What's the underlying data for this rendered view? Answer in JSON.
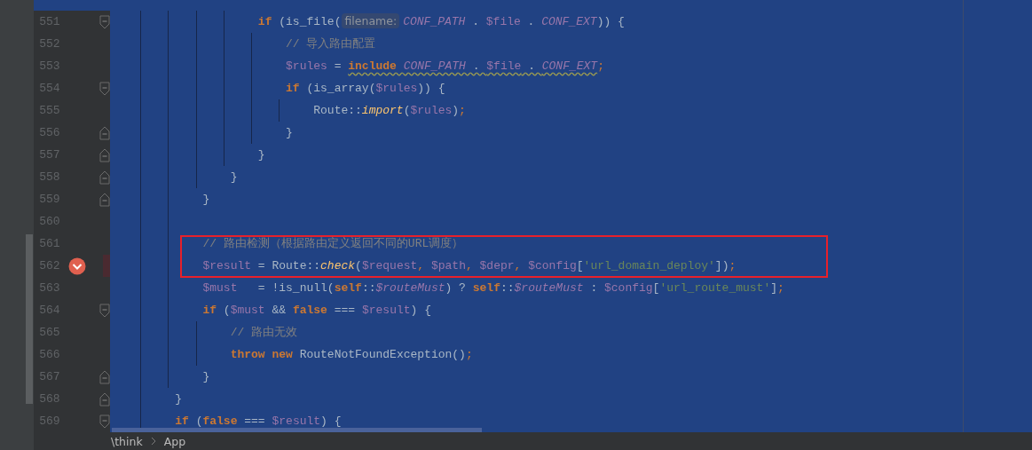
{
  "editor": {
    "lines": [
      {
        "number": "551",
        "fold_open": true,
        "fold_close": false,
        "breakpoint": false,
        "boxed": false,
        "tokens": [
          {
            "kind": "keyword",
            "text": "                    if"
          },
          {
            "kind": "plain",
            "text": " (is_file("
          },
          {
            "kind": "hint",
            "text": "filename:"
          },
          {
            "kind": "constant",
            "text": "CONF_PATH"
          },
          {
            "kind": "plain",
            "text": " . "
          },
          {
            "kind": "variable",
            "text": "$file"
          },
          {
            "kind": "plain",
            "text": " . "
          },
          {
            "kind": "constant",
            "text": "CONF_EXT"
          },
          {
            "kind": "plain",
            "text": ")) {"
          }
        ]
      },
      {
        "number": "552",
        "fold_open": false,
        "fold_close": false,
        "breakpoint": false,
        "boxed": false,
        "tokens": [
          {
            "kind": "comment",
            "text": "                        // 导入路由配置"
          }
        ]
      },
      {
        "number": "553",
        "fold_open": false,
        "fold_close": false,
        "breakpoint": false,
        "boxed": false,
        "tokens": [
          {
            "kind": "variable",
            "text": "                        $rules"
          },
          {
            "kind": "plain",
            "text": " = "
          },
          {
            "kind": "keyword",
            "text": "include ",
            "warning": true
          },
          {
            "kind": "constant",
            "text": "CONF_PATH",
            "warning": true
          },
          {
            "kind": "plain",
            "text": " . ",
            "warning": true
          },
          {
            "kind": "variable",
            "text": "$file",
            "warning": true
          },
          {
            "kind": "plain",
            "text": " . ",
            "warning": true
          },
          {
            "kind": "constant",
            "text": "CONF_EXT",
            "warning": true
          },
          {
            "kind": "punct",
            "text": ";"
          }
        ]
      },
      {
        "number": "554",
        "fold_open": true,
        "fold_close": false,
        "breakpoint": false,
        "boxed": false,
        "tokens": [
          {
            "kind": "keyword",
            "text": "                        if"
          },
          {
            "kind": "plain",
            "text": " (is_array("
          },
          {
            "kind": "variable",
            "text": "$rules"
          },
          {
            "kind": "plain",
            "text": ")) {"
          }
        ]
      },
      {
        "number": "555",
        "fold_open": false,
        "fold_close": false,
        "breakpoint": false,
        "boxed": false,
        "tokens": [
          {
            "kind": "plain",
            "text": "                            Route::"
          },
          {
            "kind": "method",
            "text": "import"
          },
          {
            "kind": "plain",
            "text": "("
          },
          {
            "kind": "variable",
            "text": "$rules"
          },
          {
            "kind": "plain",
            "text": ")"
          },
          {
            "kind": "punct",
            "text": ";"
          }
        ]
      },
      {
        "number": "556",
        "fold_open": false,
        "fold_close": true,
        "breakpoint": false,
        "boxed": false,
        "tokens": [
          {
            "kind": "plain",
            "text": "                        }"
          }
        ]
      },
      {
        "number": "557",
        "fold_open": false,
        "fold_close": true,
        "breakpoint": false,
        "boxed": false,
        "tokens": [
          {
            "kind": "plain",
            "text": "                    }"
          }
        ]
      },
      {
        "number": "558",
        "fold_open": false,
        "fold_close": true,
        "breakpoint": false,
        "boxed": false,
        "tokens": [
          {
            "kind": "plain",
            "text": "                }"
          }
        ]
      },
      {
        "number": "559",
        "fold_open": false,
        "fold_close": true,
        "breakpoint": false,
        "boxed": false,
        "tokens": [
          {
            "kind": "plain",
            "text": "            }"
          }
        ]
      },
      {
        "number": "560",
        "fold_open": false,
        "fold_close": false,
        "breakpoint": false,
        "boxed": false
      },
      {
        "number": "561",
        "fold_open": false,
        "fold_close": false,
        "breakpoint": false,
        "boxed": true,
        "tokens": [
          {
            "kind": "comment",
            "text": "            // 路由检测（根据路由定义返回不同的URL调度）"
          }
        ]
      },
      {
        "number": "562",
        "fold_open": false,
        "fold_close": false,
        "breakpoint": true,
        "boxed": true,
        "tokens": [
          {
            "kind": "variable",
            "text": "            $result"
          },
          {
            "kind": "plain",
            "text": " = Route::"
          },
          {
            "kind": "method",
            "text": "check"
          },
          {
            "kind": "plain",
            "text": "("
          },
          {
            "kind": "variable",
            "text": "$request"
          },
          {
            "kind": "punct",
            "text": ", "
          },
          {
            "kind": "variable",
            "text": "$path"
          },
          {
            "kind": "punct",
            "text": ", "
          },
          {
            "kind": "variable",
            "text": "$depr"
          },
          {
            "kind": "punct",
            "text": ", "
          },
          {
            "kind": "variable",
            "text": "$config"
          },
          {
            "kind": "plain",
            "text": "["
          },
          {
            "kind": "string",
            "text": "'url_domain_deploy'"
          },
          {
            "kind": "plain",
            "text": "])"
          },
          {
            "kind": "punct",
            "text": ";"
          }
        ]
      },
      {
        "number": "563",
        "fold_open": false,
        "fold_close": false,
        "breakpoint": false,
        "boxed": false,
        "tokens": [
          {
            "kind": "variable",
            "text": "            $must"
          },
          {
            "kind": "plain",
            "text": "   = !is_null("
          },
          {
            "kind": "keyword",
            "text": "self"
          },
          {
            "kind": "plain",
            "text": "::"
          },
          {
            "kind": "constant",
            "text": "$routeMust"
          },
          {
            "kind": "plain",
            "text": ") ? "
          },
          {
            "kind": "keyword",
            "text": "self"
          },
          {
            "kind": "plain",
            "text": "::"
          },
          {
            "kind": "constant",
            "text": "$routeMust"
          },
          {
            "kind": "plain",
            "text": " : "
          },
          {
            "kind": "variable",
            "text": "$config"
          },
          {
            "kind": "plain",
            "text": "["
          },
          {
            "kind": "string",
            "text": "'url_route_must'"
          },
          {
            "kind": "plain",
            "text": "]"
          },
          {
            "kind": "punct",
            "text": ";"
          }
        ]
      },
      {
        "number": "564",
        "fold_open": true,
        "fold_close": false,
        "breakpoint": false,
        "boxed": false,
        "tokens": [
          {
            "kind": "keyword",
            "text": "            if"
          },
          {
            "kind": "plain",
            "text": " ("
          },
          {
            "kind": "variable",
            "text": "$must"
          },
          {
            "kind": "plain",
            "text": " && "
          },
          {
            "kind": "keyword",
            "text": "false"
          },
          {
            "kind": "plain",
            "text": " === "
          },
          {
            "kind": "variable",
            "text": "$result"
          },
          {
            "kind": "plain",
            "text": ") {"
          }
        ]
      },
      {
        "number": "565",
        "fold_open": false,
        "fold_close": false,
        "breakpoint": false,
        "boxed": false,
        "tokens": [
          {
            "kind": "comment",
            "text": "                // 路由无效"
          }
        ]
      },
      {
        "number": "566",
        "fold_open": false,
        "fold_close": false,
        "breakpoint": false,
        "boxed": false,
        "tokens": [
          {
            "kind": "keyword",
            "text": "                throw new"
          },
          {
            "kind": "plain",
            "text": " RouteNotFoundException()"
          },
          {
            "kind": "punct",
            "text": ";"
          }
        ]
      },
      {
        "number": "567",
        "fold_open": false,
        "fold_close": true,
        "breakpoint": false,
        "boxed": false,
        "tokens": [
          {
            "kind": "plain",
            "text": "            }"
          }
        ]
      },
      {
        "number": "568",
        "fold_open": false,
        "fold_close": true,
        "breakpoint": false,
        "boxed": false,
        "tokens": [
          {
            "kind": "plain",
            "text": "        }"
          }
        ]
      },
      {
        "number": "569",
        "fold_open": true,
        "fold_close": false,
        "breakpoint": false,
        "boxed": false,
        "tokens": [
          {
            "kind": "keyword",
            "text": "        if"
          },
          {
            "kind": "plain",
            "text": " ("
          },
          {
            "kind": "keyword",
            "text": "false"
          },
          {
            "kind": "plain",
            "text": " === "
          },
          {
            "kind": "variable",
            "text": "$result"
          },
          {
            "kind": "plain",
            "text": ") {"
          }
        ]
      }
    ]
  },
  "breadcrumbs": [
    "\\think",
    "App"
  ]
}
